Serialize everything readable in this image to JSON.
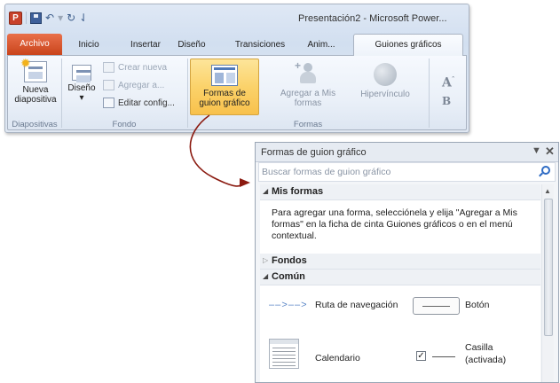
{
  "window": {
    "title": "Presentación2 - Microsoft Power..."
  },
  "quick_access": {
    "app_icon_letter": "P"
  },
  "tabs": [
    "Archivo",
    "Inicio",
    "Insertar",
    "Diseño",
    "Transiciones",
    "Anim...",
    "Guiones gráficos"
  ],
  "ribbon": {
    "group_slides": {
      "label": "Diapositivas",
      "new_slide": "Nueva diapositiva"
    },
    "group_background": {
      "label": "Fondo",
      "layout": "Diseño",
      "create_new": "Crear nueva",
      "add": "Agregar a...",
      "edit_config": "Editar config..."
    },
    "group_shapes": {
      "label": "Formas",
      "storyboard_shapes_l1": "Formas de",
      "storyboard_shapes_l2": "guion gráfico",
      "add_to_mine_l1": "Agregar a Mis",
      "add_to_mine_l2": "formas",
      "hyperlink": "Hipervínculo"
    },
    "font_glyph_a": "A",
    "font_glyph_b": "B"
  },
  "pane": {
    "title": "Formas de guion gráfico",
    "search_placeholder": "Buscar formas de guion gráfico",
    "sections": {
      "mine": "Mis formas",
      "backgrounds": "Fondos",
      "common": "Común"
    },
    "info_text": "Para agregar una forma, selecciónela y elija \"Agregar a Mis formas\" en la ficha de cinta Guiones gráficos o en el menú contextual.",
    "shapes": {
      "breadcrumb": "Ruta de navegación",
      "button": "Botón",
      "calendar": "Calendario",
      "checkbox_l1": "Casilla",
      "checkbox_l2": "(activada)"
    }
  },
  "colors": {
    "file_tab": "#d4502a",
    "highlight": "#fbd26a",
    "arrow": "#8b1a10",
    "search_icon": "#2e6bc4"
  }
}
